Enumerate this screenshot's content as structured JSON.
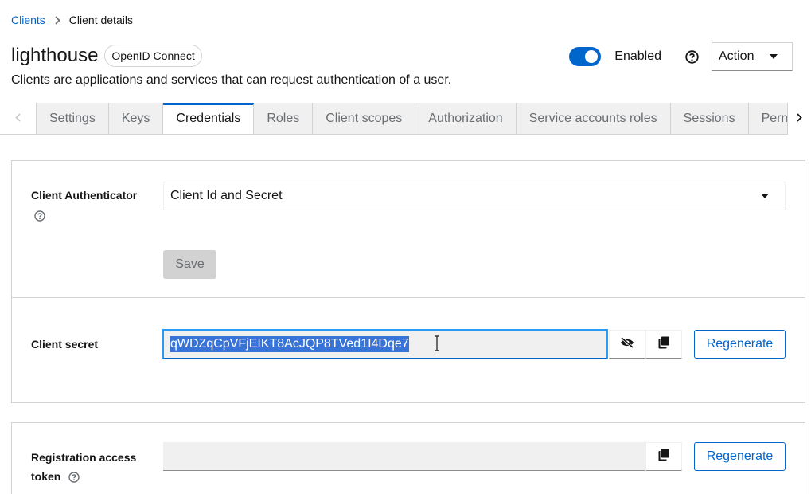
{
  "breadcrumb": {
    "parent": "Clients",
    "current": "Client details"
  },
  "header": {
    "title": "lighthouse",
    "protocol_badge": "OpenID Connect",
    "subtitle": "Clients are applications and services that can request authentication of a user.",
    "enabled_label": "Enabled",
    "enabled": true,
    "action_label": "Action"
  },
  "tabs": [
    {
      "label": "Settings"
    },
    {
      "label": "Keys"
    },
    {
      "label": "Credentials",
      "active": true
    },
    {
      "label": "Roles"
    },
    {
      "label": "Client scopes"
    },
    {
      "label": "Authorization"
    },
    {
      "label": "Service accounts roles"
    },
    {
      "label": "Sessions"
    },
    {
      "label": "Permissions"
    }
  ],
  "credentials": {
    "authenticator_label": "Client Authenticator",
    "authenticator_value": "Client Id and Secret",
    "save_label": "Save",
    "secret_label": "Client secret",
    "secret_value": "qWDZqCpVFjEIKT8AcJQP8TVed1I4Dqe7",
    "regenerate_label": "Regenerate",
    "registration_label_line1": "Registration access",
    "registration_label_line2": "token",
    "registration_value": ""
  },
  "colors": {
    "accent": "#0066cc",
    "selection": "#3874d8",
    "focus": "#2b9af3"
  }
}
